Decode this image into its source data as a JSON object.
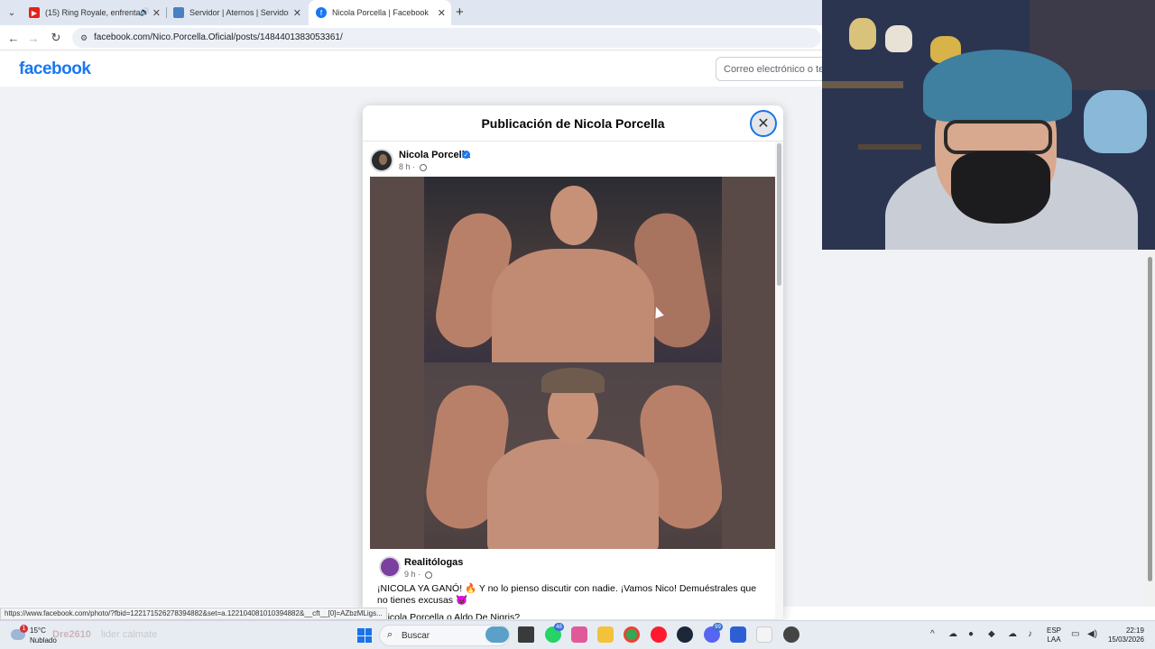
{
  "browser": {
    "tabs": [
      {
        "title": "(15) Ring Royale, enfrentam",
        "favicon": "youtube-icon",
        "active": false,
        "audio": true
      },
      {
        "title": "Servidor | Aternos | Servidor de",
        "favicon": "aternos-icon",
        "active": false,
        "audio": false
      },
      {
        "title": "Nicola Porcella | Facebook",
        "favicon": "facebook-icon",
        "active": true,
        "audio": false
      }
    ],
    "new_tab_symbol": "+",
    "url": "facebook.com/Nico.Porcella.Oficial/posts/1484401383053361/"
  },
  "facebook": {
    "logo": "facebook",
    "email_placeholder": "Correo electrónico o tel",
    "dialog_title": "Publicación de Nicola Porcella",
    "post": {
      "author": "Nicola Porcella",
      "time": "8 h ·",
      "shared": {
        "page_name": "Realitólogas",
        "time": "9 h ·",
        "text_line1": "¡NICOLA YA GANÓ! 🔥 Y no lo pienso discutir con nadie. ¡Vamos Nico! Demuéstrales que no tienes excusas 😈",
        "text_line2": "Nicola Porcella o Aldo De Nigris?"
      }
    }
  },
  "status_url": "https://www.facebook.com/photo/?fbid=122171526278394882&set=a.122104081010394882&__cft__[0]=AZbzMLigs...",
  "taskbar": {
    "weather_temp": "15°C",
    "weather_desc": "Nublado",
    "weather_badge": "1",
    "overlay_user": "Dre2610",
    "overlay_msg": "lider calmate",
    "search_label": "Buscar",
    "badge_whatsapp": "48",
    "badge_discord": "99",
    "lang_line1": "ESP",
    "lang_line2": "LAA",
    "time": "22:19",
    "date": "15/03/2026"
  },
  "colors": {
    "facebook_blue": "#1877f2",
    "page_bg": "#f0f2f5",
    "tabbar_bg": "#dfe6f1"
  }
}
